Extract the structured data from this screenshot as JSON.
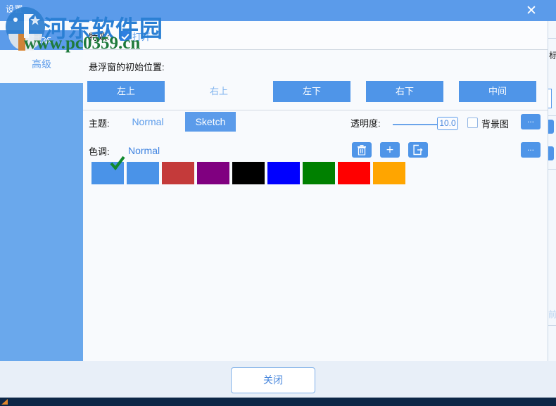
{
  "window": {
    "title": "设置",
    "close_glyph": "✕"
  },
  "sidebar": {
    "items": [
      {
        "label": "基本",
        "selected": true
      },
      {
        "label": "高级",
        "selected": false
      }
    ]
  },
  "effects": {
    "label": "特效:",
    "checkbox_checked": true,
    "on_label": "打开"
  },
  "position": {
    "title": "悬浮窗的初始位置:",
    "buttons": [
      {
        "label": "左上",
        "selected": true
      },
      {
        "label": "右上",
        "selected": false
      },
      {
        "label": "左下",
        "selected": true
      },
      {
        "label": "右下",
        "selected": true
      },
      {
        "label": "中间",
        "selected": true
      }
    ]
  },
  "theme": {
    "label": "主题:",
    "normal_label": "Normal",
    "sketch_label": "Sketch",
    "selected": "Sketch"
  },
  "tone": {
    "label": "色调:",
    "value": "Normal"
  },
  "transparency": {
    "label": "透明度:",
    "value": "10.0",
    "slider_percent": 70
  },
  "background_image": {
    "label": "背景图",
    "checked": false,
    "browse_label": "..."
  },
  "icon_buttons": {
    "delete_label": "...",
    "add_label": "+",
    "export_label": "...",
    "more_label": "..."
  },
  "colors": {
    "selected_index": 0,
    "check_color": "#118a2e",
    "swatches": [
      "#4a93e8",
      "#4a93e8",
      "#c43a3a",
      "#800080",
      "#000000",
      "#0000ff",
      "#008000",
      "#ff0000",
      "#ffa500"
    ]
  },
  "footer": {
    "close_label": "关闭"
  },
  "right_edge": {
    "partial_text": "标",
    "faint_text": "前页"
  },
  "watermark": {
    "title": "河东软件园",
    "url": "www.pc0359.cn"
  },
  "accent": {
    "primary": "#5b9bea",
    "button": "#4f95e8",
    "link": "#4a88dd"
  }
}
